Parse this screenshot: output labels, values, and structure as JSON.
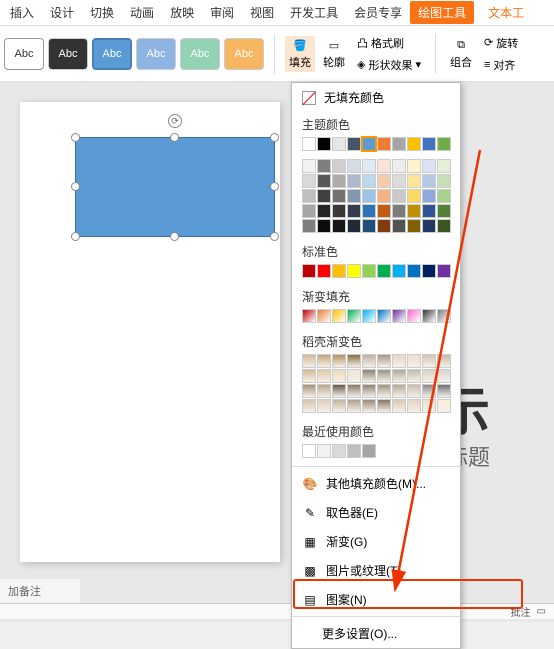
{
  "tabs": {
    "insert": "插入",
    "design": "设计",
    "transition": "切换",
    "animation": "动画",
    "slideshow": "放映",
    "review": "审阅",
    "view": "视图",
    "devtools": "开发工具",
    "member": "会员专享",
    "drawing_tool": "绘图工具",
    "text_tool": "文本工"
  },
  "styles_label": "Abc",
  "toolbar": {
    "fill": "填充",
    "outline": "轮廓",
    "format": "格式刷",
    "shape_effects": "形状效果",
    "combine": "组合",
    "rotate": "旋转",
    "align": "对齐"
  },
  "dropdown": {
    "no_fill": "无填充颜色",
    "theme_colors": "主题颜色",
    "standard_colors": "标准色",
    "gradient_fill": "渐变填充",
    "shell_gradient": "稻壳渐变色",
    "recent_colors": "最近使用颜色",
    "more_fill": "其他填充颜色(M)...",
    "eyedropper": "取色器(E)",
    "gradient": "渐变(G)",
    "picture_texture": "图片或纹理(T)",
    "pattern": "图案(N)",
    "more_settings": "更多设置(O)..."
  },
  "slide_text": {
    "big": "示",
    "sub": "标题"
  },
  "notes": "加备注",
  "status": {
    "comments": "批注"
  },
  "theme_row1": [
    "#ffffff",
    "#000000",
    "#e7e6e6",
    "#44546a",
    "#5b9bd5",
    "#ed7d31",
    "#a5a5a5",
    "#ffc000",
    "#4472c4",
    "#70ad47"
  ],
  "theme_rows": [
    [
      "#f2f2f2",
      "#7f7f7f",
      "#d0cece",
      "#d6dce5",
      "#deebf7",
      "#fbe5d6",
      "#ededed",
      "#fff2cc",
      "#dae3f3",
      "#e2f0d9"
    ],
    [
      "#d9d9d9",
      "#595959",
      "#aeabab",
      "#adb9ca",
      "#bdd7ee",
      "#f8cbad",
      "#dbdbdb",
      "#ffe699",
      "#b4c7e7",
      "#c5e0b4"
    ],
    [
      "#bfbfbf",
      "#404040",
      "#757171",
      "#8497b0",
      "#9dc3e6",
      "#f4b183",
      "#c9c9c9",
      "#ffd966",
      "#8faadc",
      "#a9d18e"
    ],
    [
      "#a6a6a6",
      "#262626",
      "#3b3838",
      "#333f50",
      "#2e75b6",
      "#c55a11",
      "#7b7b7b",
      "#bf9000",
      "#2f5597",
      "#548235"
    ],
    [
      "#7f7f7f",
      "#0d0d0d",
      "#171717",
      "#222a35",
      "#1f4e79",
      "#843c0c",
      "#525252",
      "#806000",
      "#203864",
      "#385723"
    ]
  ],
  "std_colors": [
    "#c00000",
    "#ff0000",
    "#ffc000",
    "#ffff00",
    "#92d050",
    "#00b050",
    "#00b0f0",
    "#0070c0",
    "#002060",
    "#7030a0"
  ],
  "grad_colors": [
    "#c00000",
    "#ed7d31",
    "#ffc000",
    "#00b050",
    "#00b0f0",
    "#0070c0",
    "#7030a0",
    "#ff66cc",
    "#333333",
    "#808080"
  ],
  "shell_rows": [
    [
      "#d4b896",
      "#c4a57b",
      "#b59260",
      "#8b6f3e",
      "#c0b0a0",
      "#a89990",
      "#e8d5c5",
      "#f0dcc8",
      "#d5c4b0",
      "#c8b8a5"
    ],
    [
      "#d4b896",
      "#e0c8a8",
      "#ecd9ba",
      "#f0e5d5",
      "#888070",
      "#9c9484",
      "#b0a898",
      "#c4bcac",
      "#d8d0c0",
      "#d5d5d5"
    ],
    [
      "#a8907c",
      "#bca690",
      "#6b5a48",
      "#8d7a64",
      "#908070",
      "#a49484",
      "#b8a898",
      "#ccbcac",
      "#8a8a8a",
      "#707070"
    ],
    [
      "#d4c4b0",
      "#e0d0bc",
      "#c4b4a0",
      "#b0a08c",
      "#9c8c78",
      "#887864",
      "#d8c8b4",
      "#e4d4c0",
      "#f0e0cc",
      "#fceed8"
    ]
  ],
  "recent_row": [
    "#ffffff",
    "#f2f2f2",
    "#d9d9d9",
    "#bfbfbf",
    "#a6a6a6"
  ]
}
